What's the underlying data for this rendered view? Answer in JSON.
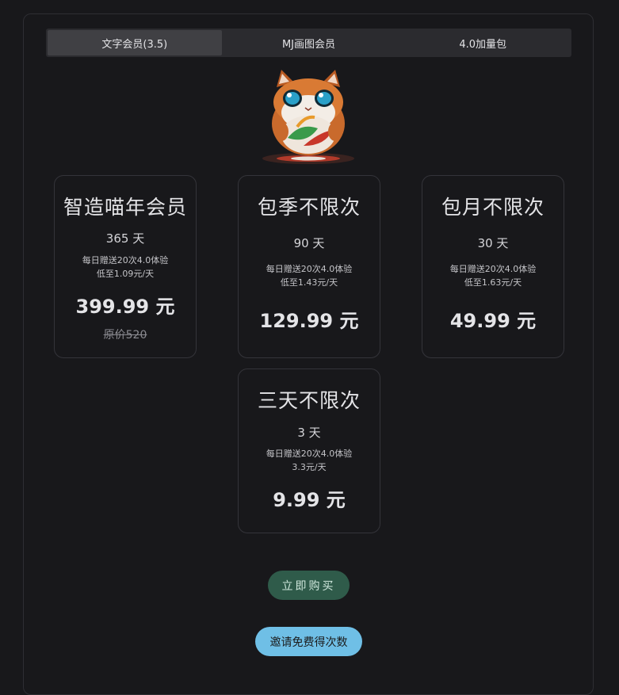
{
  "tabs": [
    {
      "label": "文字会员(3.5)",
      "active": true
    },
    {
      "label": "MJ画图会员",
      "active": false
    },
    {
      "label": "4.0加量包",
      "active": false
    }
  ],
  "plans": [
    {
      "title": "智造喵年会员",
      "days": "365 天",
      "note1": "每日赠送20次4.0体验",
      "note2": "低至1.09元/天",
      "price": "399.99 元",
      "original": "原价520"
    },
    {
      "title": "包季不限次",
      "days": "90 天",
      "note1": "每日赠送20次4.0体验",
      "note2": "低至1.43元/天",
      "price": "129.99 元"
    },
    {
      "title": "包月不限次",
      "days": "30 天",
      "note1": "每日赠送20次4.0体验",
      "note2": "低至1.63元/天",
      "price": "49.99 元"
    },
    {
      "title": "三天不限次",
      "days": "3 天",
      "note1": "每日赠送20次4.0体验",
      "note2": "3.3元/天",
      "price": "9.99 元"
    }
  ],
  "buttons": {
    "buy": "立即购买",
    "invite": "邀请免费得次数"
  },
  "colors": {
    "background": "#18181b",
    "buy_button": "#2f5b4a",
    "invite_button": "#6fbfe6"
  }
}
